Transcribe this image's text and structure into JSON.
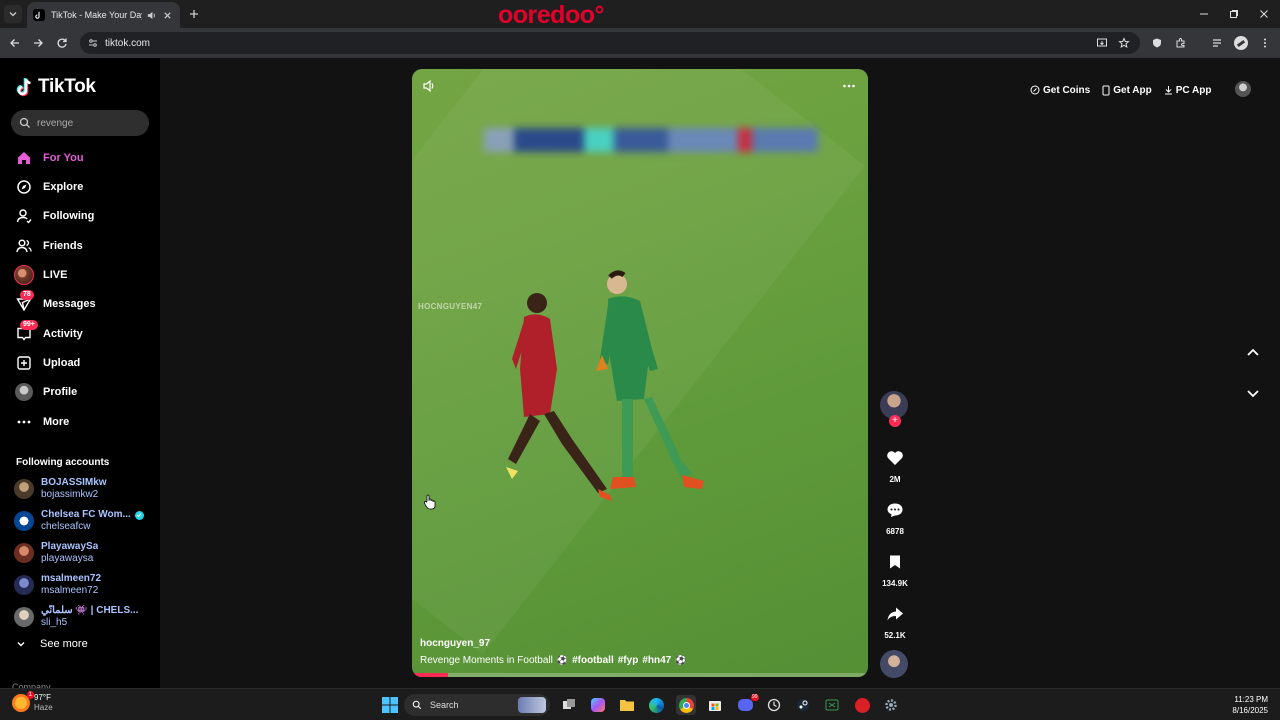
{
  "browser": {
    "tab_title": "TikTok - Make Your Day",
    "url": "tiktok.com",
    "brand_overlay": "ooredoo°"
  },
  "sidebar": {
    "logo_text": "TikTok",
    "search_value": "revenge",
    "nav": [
      {
        "label": "For You",
        "icon": "home-icon",
        "active": true
      },
      {
        "label": "Explore",
        "icon": "compass-icon"
      },
      {
        "label": "Following",
        "icon": "following-icon"
      },
      {
        "label": "Friends",
        "icon": "friends-icon"
      },
      {
        "label": "LIVE",
        "icon": "live-icon"
      },
      {
        "label": "Messages",
        "icon": "messages-icon",
        "badge": "78"
      },
      {
        "label": "Activity",
        "icon": "activity-icon",
        "badge": "99+"
      },
      {
        "label": "Upload",
        "icon": "upload-icon"
      },
      {
        "label": "Profile",
        "icon": "profile-icon"
      },
      {
        "label": "More",
        "icon": "more-icon"
      }
    ],
    "following_title": "Following accounts",
    "accounts": [
      {
        "name": "BOJASSIMkw",
        "handle": "bojassimkw2"
      },
      {
        "name": "Chelsea FC Wom...",
        "handle": "chelseafcw",
        "verified": true
      },
      {
        "name": "PlayawaySa",
        "handle": "playawaysa"
      },
      {
        "name": "msalmeen72",
        "handle": "msalmeen72"
      },
      {
        "name": "سلمانّي 👾 | CHELS...",
        "handle": "sli_h5"
      }
    ],
    "see_more": "See more",
    "cut_label": "Company"
  },
  "video": {
    "watermark": "HOCNGUYEN47",
    "author": "hocnguyen_97",
    "caption": "Revenge Moments in Football",
    "tags": [
      "#football",
      "#fyp",
      "#hn47"
    ],
    "progress": 0.08
  },
  "actions": {
    "likes": "2M",
    "comments": "6878",
    "saves": "134.9K",
    "shares": "52.1K"
  },
  "topbar": {
    "get_coins": "Get Coins",
    "get_app": "Get App",
    "pc_app": "PC App"
  },
  "taskbar": {
    "temp": "97°F",
    "weather": "Haze",
    "search": "Search",
    "time": "11:23 PM",
    "date": "8/16/2025"
  },
  "colors": {
    "accent": "#fe2c55",
    "link": "#aac4ff",
    "active_nav": "#e65bd8",
    "brand": "#e4002b"
  }
}
